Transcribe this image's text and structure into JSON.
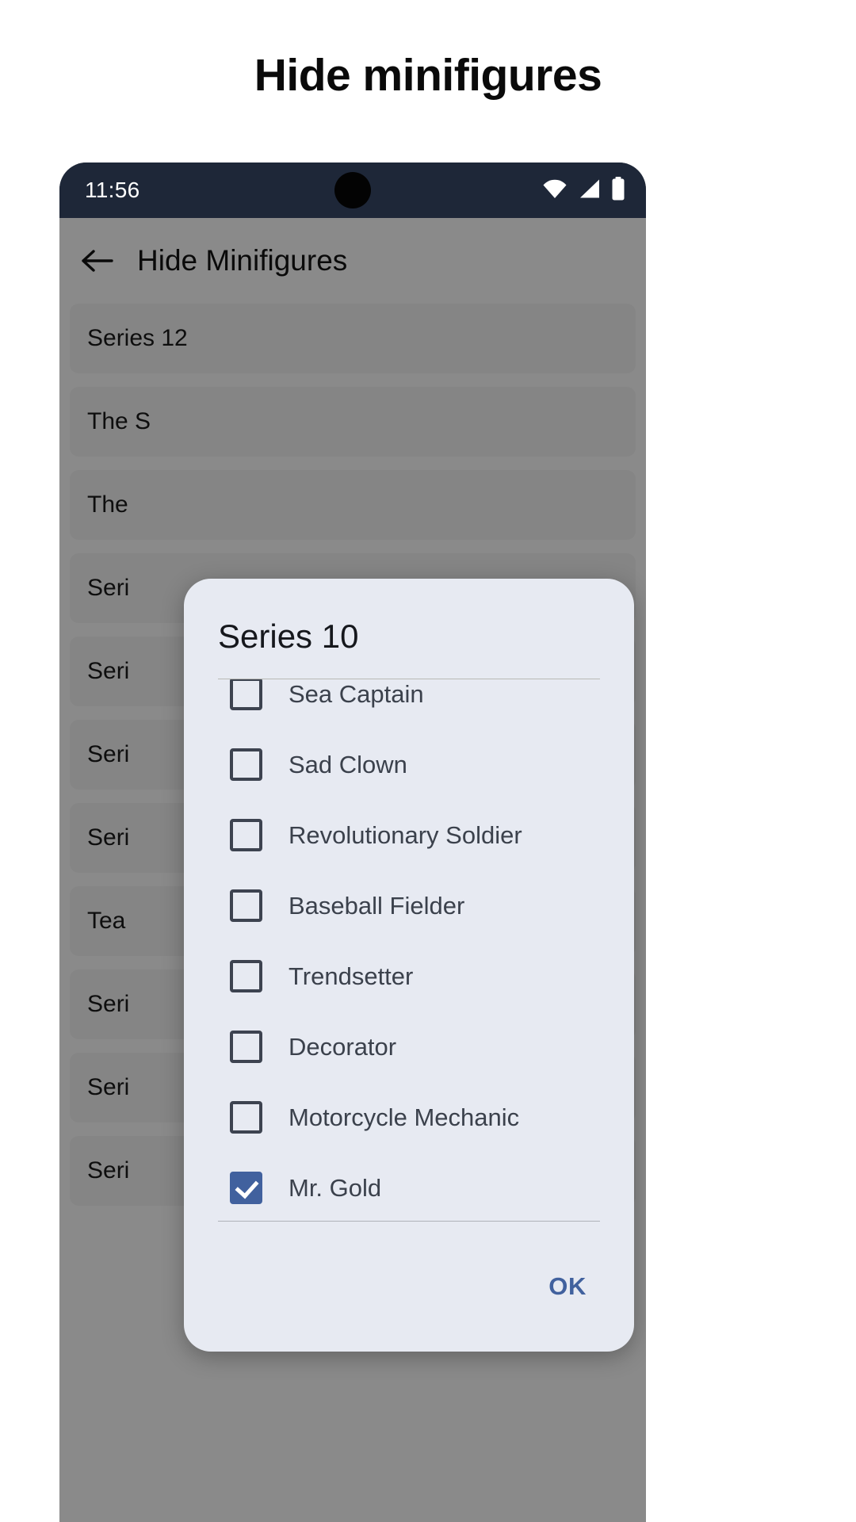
{
  "page": {
    "heading": "Hide minifigures"
  },
  "status_bar": {
    "time": "11:56",
    "wifi_icon": "wifi-icon",
    "signal_icon": "cellular-signal-icon",
    "battery_icon": "battery-full-icon",
    "background_color": "#1E2738",
    "text_color": "#FFFFFF"
  },
  "app": {
    "back_icon": "back-arrow-icon",
    "title": "Hide Minifigures",
    "list_rows": [
      {
        "label": "Series 12"
      },
      {
        "label": "The S"
      },
      {
        "label": "The "
      },
      {
        "label": "Seri"
      },
      {
        "label": "Seri"
      },
      {
        "label": "Seri"
      },
      {
        "label": "Seri"
      },
      {
        "label": "Tea"
      },
      {
        "label": "Seri"
      },
      {
        "label": "Seri"
      },
      {
        "label": "Seri"
      }
    ]
  },
  "dialog": {
    "title": "Series 10",
    "background_color": "#E7EAF2",
    "checkbox_checked_color": "#41619E",
    "checkbox_unchecked_color": "#3D4350",
    "items": [
      {
        "label": "Sea Captain",
        "checked": false
      },
      {
        "label": "Sad Clown",
        "checked": false
      },
      {
        "label": "Revolutionary Soldier",
        "checked": false
      },
      {
        "label": "Baseball Fielder",
        "checked": false
      },
      {
        "label": "Trendsetter",
        "checked": false
      },
      {
        "label": "Decorator",
        "checked": false
      },
      {
        "label": "Motorcycle Mechanic",
        "checked": false
      },
      {
        "label": "Mr. Gold",
        "checked": true
      }
    ],
    "ok_label": "OK",
    "ok_color": "#41619E"
  }
}
